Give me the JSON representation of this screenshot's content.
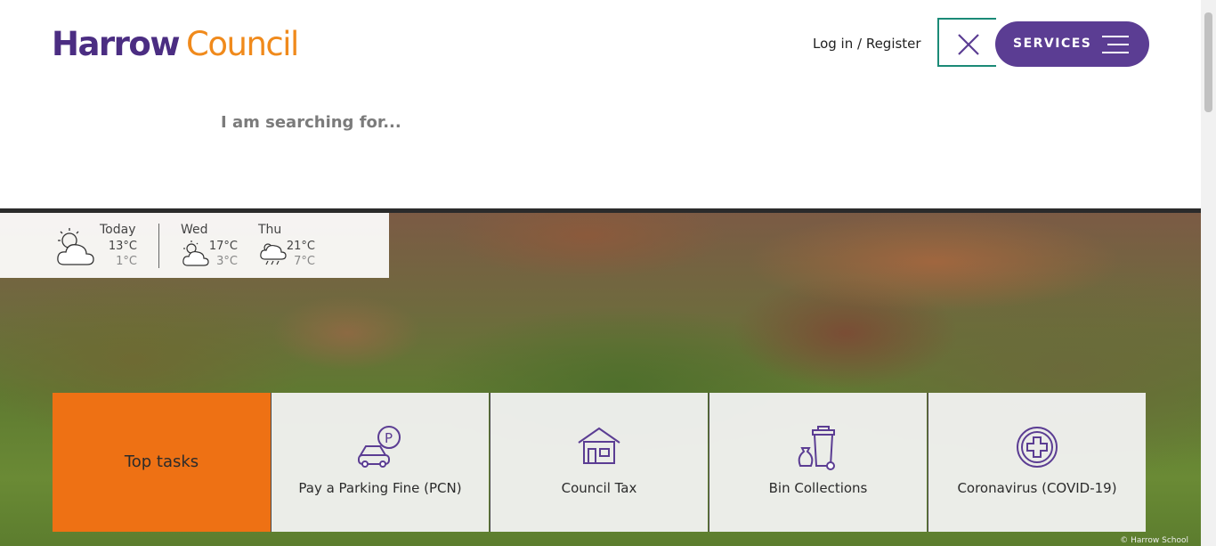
{
  "header": {
    "logo_primary": "Harrow",
    "logo_secondary": "Council",
    "login_label": "Log in / Register",
    "services_label": "SERVICES",
    "close_icon": "close-icon",
    "menu_icon": "hamburger-icon"
  },
  "search": {
    "placeholder": "I am searching for..."
  },
  "weather": {
    "days": [
      {
        "label": "Today",
        "high": "13°C",
        "low": "1°C",
        "icon": "partly-cloudy-icon"
      },
      {
        "label": "Wed",
        "high": "17°C",
        "low": "3°C",
        "icon": "partly-cloudy-icon"
      },
      {
        "label": "Thu",
        "high": "21°C",
        "low": "7°C",
        "icon": "rain-cloud-icon"
      }
    ]
  },
  "top_tasks": {
    "heading": "Top tasks",
    "items": [
      {
        "label": "Pay a Parking Fine (PCN)",
        "icon": "parking-car-icon"
      },
      {
        "label": "Council Tax",
        "icon": "house-icon"
      },
      {
        "label": "Bin Collections",
        "icon": "bin-icon"
      },
      {
        "label": "Coronavirus (COVID-19)",
        "icon": "medical-cross-icon"
      }
    ]
  },
  "hero": {
    "credit": "© Harrow School"
  },
  "colors": {
    "brand_purple": "#4b2d82",
    "brand_orange": "#f08a1c",
    "services_bg": "#5b3d93",
    "close_border": "#1b8a77",
    "top_tasks_bg": "#ee7114",
    "icon_purple": "#5b3d93"
  }
}
